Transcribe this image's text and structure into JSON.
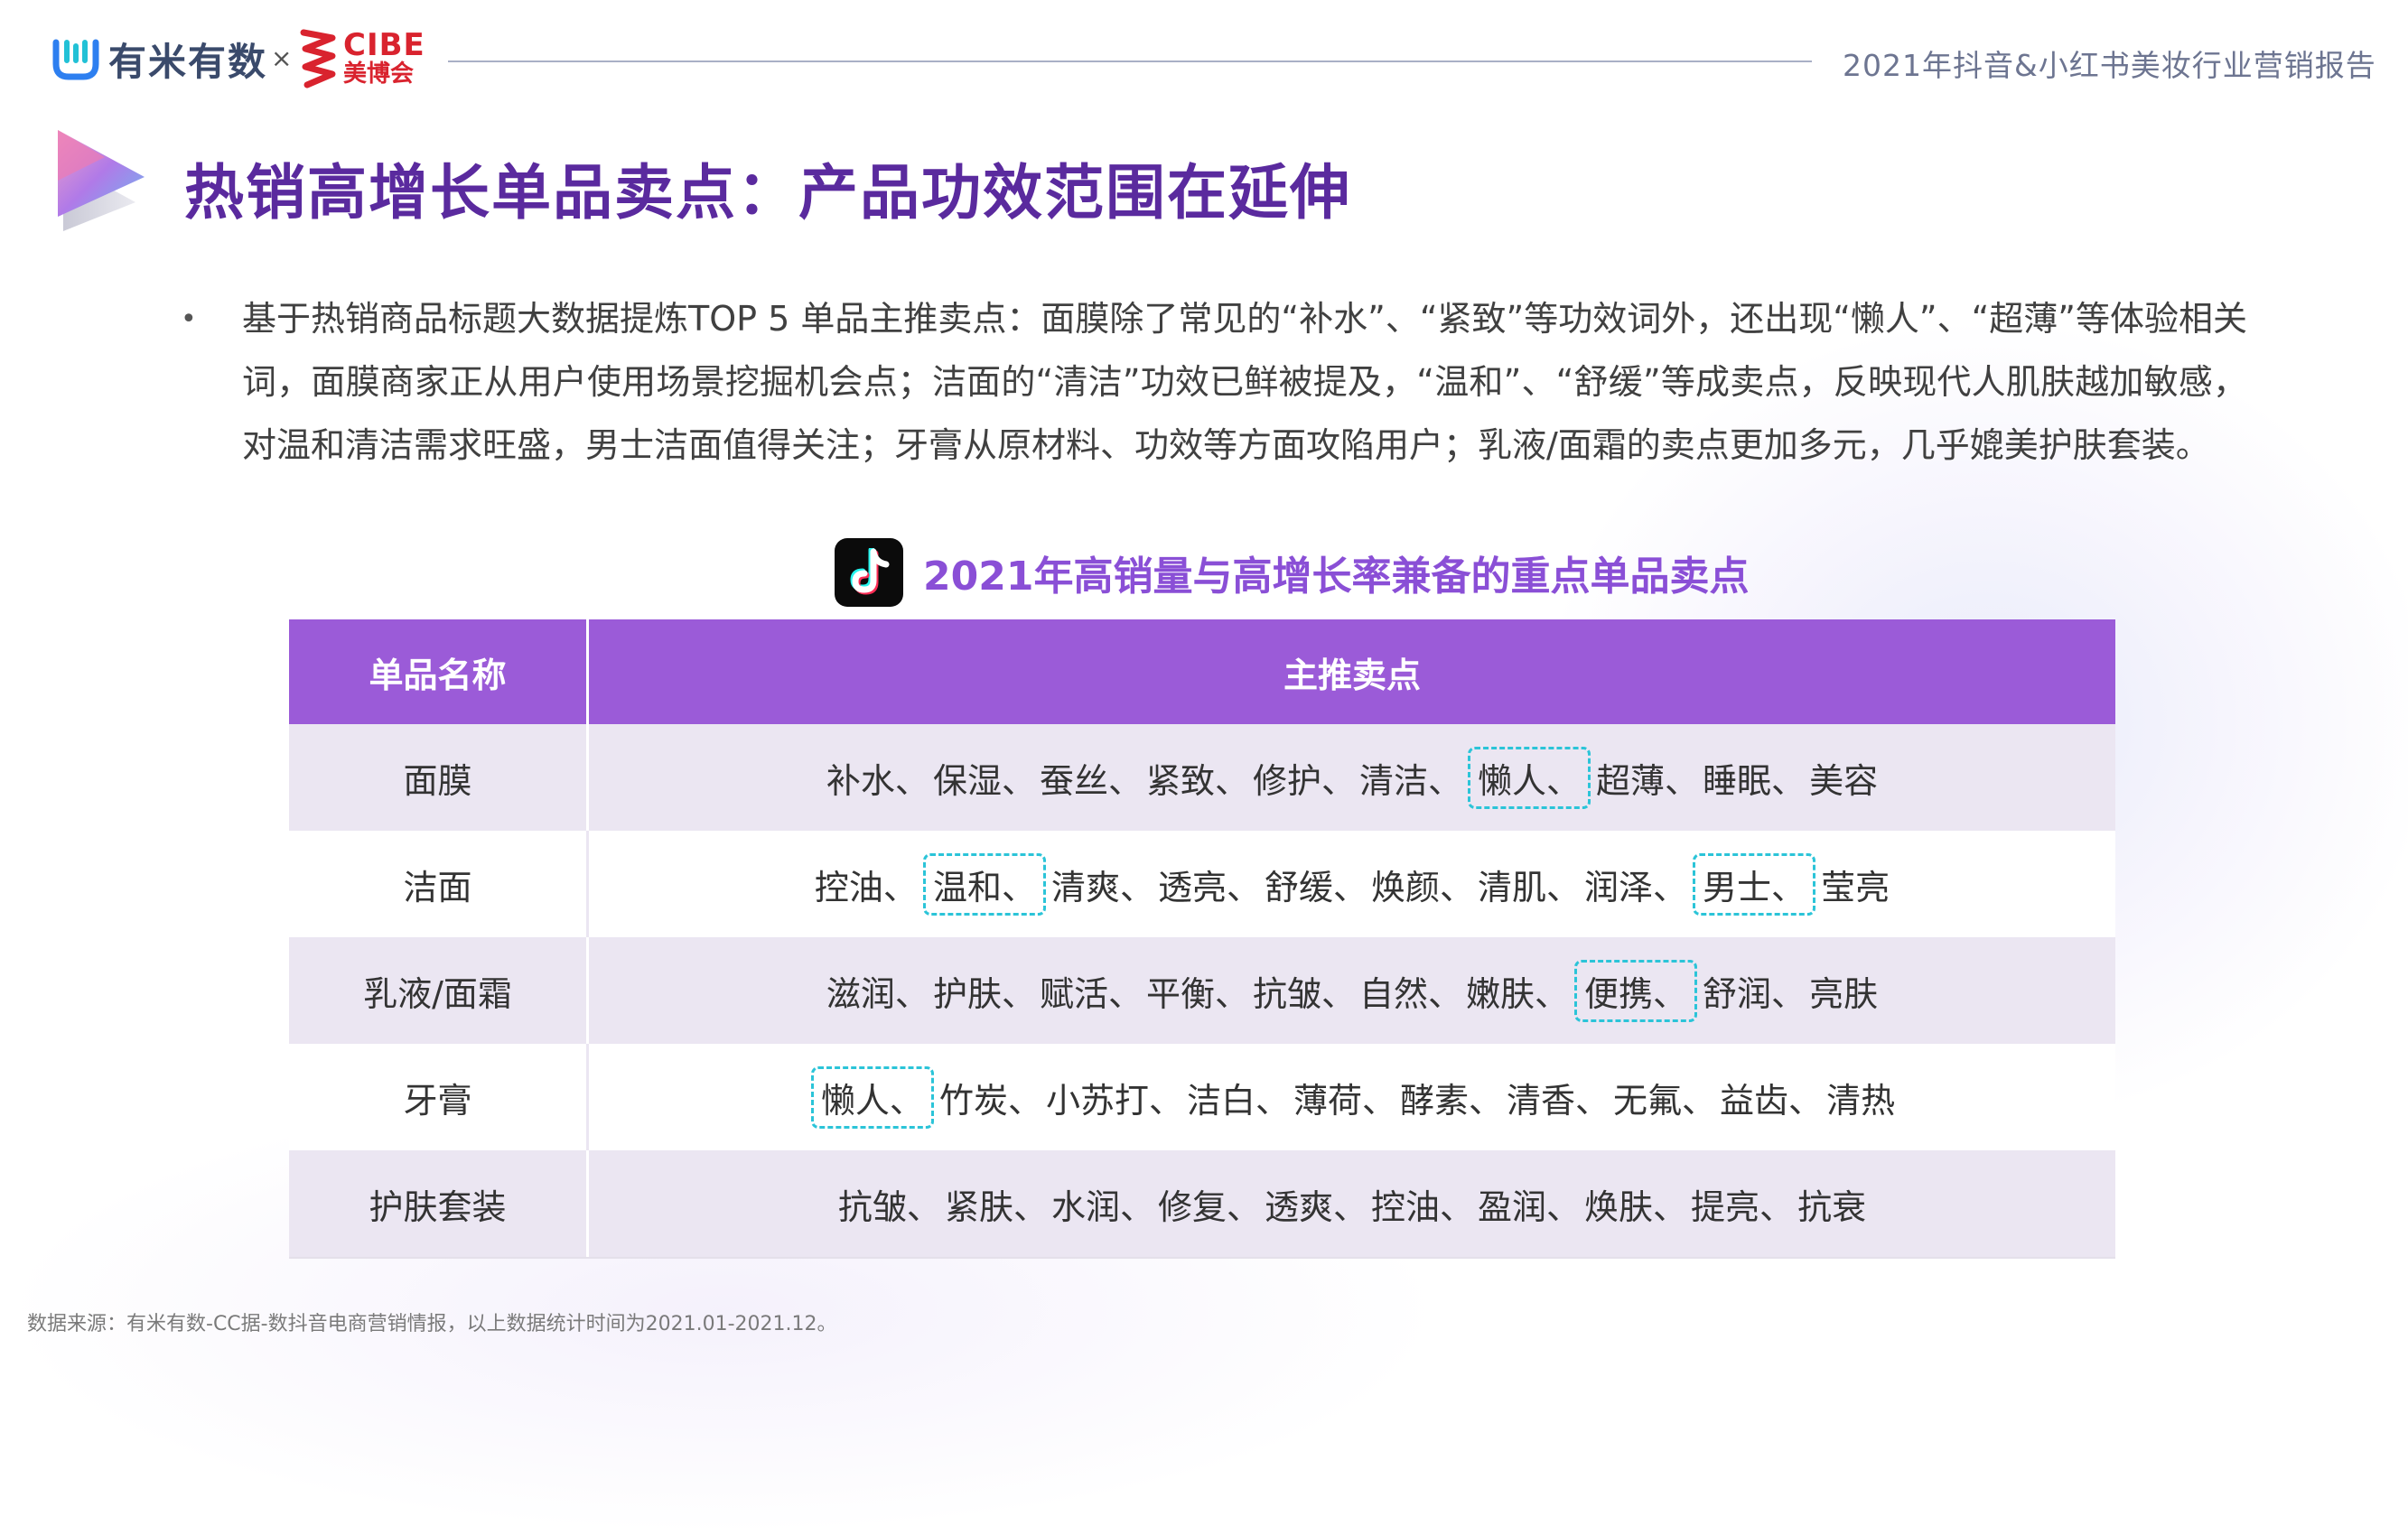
{
  "header": {
    "youmi_logo_text": "有米有数",
    "times_sign": "×",
    "cibe_logo_text_en": "CIBE",
    "cibe_logo_text_cn": "美博会",
    "report_title": "2021年抖音&小红书美妆行业营销报告"
  },
  "slide": {
    "title": "热销高增长单品卖点：产品功效范围在延伸",
    "bullet": "•",
    "body": "基于热销商品标题大数据提炼TOP 5 单品主推卖点：面膜除了常见的“补水”、“紧致”等功效词外，还出现“懒人”、“超薄”等体验相关词，面膜商家正从用户使用场景挖掘机会点；洁面的“清洁”功效已鲜被提及，“温和”、“舒缓”等成卖点，反映现代人肌肤越加敏感，对温和清洁需求旺盛，男士洁面值得关注；牙膏从原材料、功效等方面攻陷用户；乳液/面霜的卖点更加多元，几乎媲美护肤套装。"
  },
  "table": {
    "caption": "2021年高销量与高增长率兼备的重点单品卖点",
    "headers": [
      "单品名称",
      "主推卖点"
    ],
    "rows": [
      {
        "name": "面膜",
        "points": [
          {
            "text": "补水、",
            "hl": false
          },
          {
            "text": "保湿、",
            "hl": false
          },
          {
            "text": "蚕丝、",
            "hl": false
          },
          {
            "text": "紧致、",
            "hl": false
          },
          {
            "text": "修护、",
            "hl": false
          },
          {
            "text": "清洁、",
            "hl": false
          },
          {
            "text": "懒人、",
            "hl": true
          },
          {
            "text": "超薄、",
            "hl": false
          },
          {
            "text": "睡眠、",
            "hl": false
          },
          {
            "text": "美容",
            "hl": false
          }
        ]
      },
      {
        "name": "洁面",
        "points": [
          {
            "text": "控油、",
            "hl": false
          },
          {
            "text": "温和、",
            "hl": true
          },
          {
            "text": "清爽、",
            "hl": false
          },
          {
            "text": "透亮、",
            "hl": false
          },
          {
            "text": "舒缓、",
            "hl": false
          },
          {
            "text": "焕颜、",
            "hl": false
          },
          {
            "text": "清肌、",
            "hl": false
          },
          {
            "text": "润泽、",
            "hl": false
          },
          {
            "text": "男士、",
            "hl": true
          },
          {
            "text": "莹亮",
            "hl": false
          }
        ]
      },
      {
        "name": "乳液/面霜",
        "points": [
          {
            "text": "滋润、",
            "hl": false
          },
          {
            "text": "护肤、",
            "hl": false
          },
          {
            "text": "赋活、",
            "hl": false
          },
          {
            "text": "平衡、",
            "hl": false
          },
          {
            "text": "抗皱、",
            "hl": false
          },
          {
            "text": "自然、",
            "hl": false
          },
          {
            "text": "嫩肤、",
            "hl": false
          },
          {
            "text": "便携、",
            "hl": true
          },
          {
            "text": "舒润、",
            "hl": false
          },
          {
            "text": "亮肤",
            "hl": false
          }
        ]
      },
      {
        "name": "牙膏",
        "points": [
          {
            "text": "懒人、",
            "hl": true
          },
          {
            "text": "竹炭、",
            "hl": false
          },
          {
            "text": "小苏打、",
            "hl": false
          },
          {
            "text": "洁白、",
            "hl": false
          },
          {
            "text": "薄荷、",
            "hl": false
          },
          {
            "text": "酵素、",
            "hl": false
          },
          {
            "text": "清香、",
            "hl": false
          },
          {
            "text": "无氟、",
            "hl": false
          },
          {
            "text": "益齿、",
            "hl": false
          },
          {
            "text": "清热",
            "hl": false
          }
        ]
      },
      {
        "name": "护肤套装",
        "points": [
          {
            "text": "抗皱、",
            "hl": false
          },
          {
            "text": "紧肤、",
            "hl": false
          },
          {
            "text": "水润、",
            "hl": false
          },
          {
            "text": "修复、",
            "hl": false
          },
          {
            "text": "透爽、",
            "hl": false
          },
          {
            "text": "控油、",
            "hl": false
          },
          {
            "text": "盈润、",
            "hl": false
          },
          {
            "text": "焕肤、",
            "hl": false
          },
          {
            "text": "提亮、",
            "hl": false
          },
          {
            "text": "抗衰",
            "hl": false
          }
        ]
      }
    ]
  },
  "source": "数据来源：有米有数-CC据-数抖音电商营销情报，以上数据统计时间为2021.01-2021.12。",
  "colors": {
    "title": "#5a2a9e",
    "caption": "#8a4fd6",
    "table_header": "#9b5bd8",
    "row_shade": "#ebe6f2",
    "highlight_border": "#2bc4d8"
  }
}
